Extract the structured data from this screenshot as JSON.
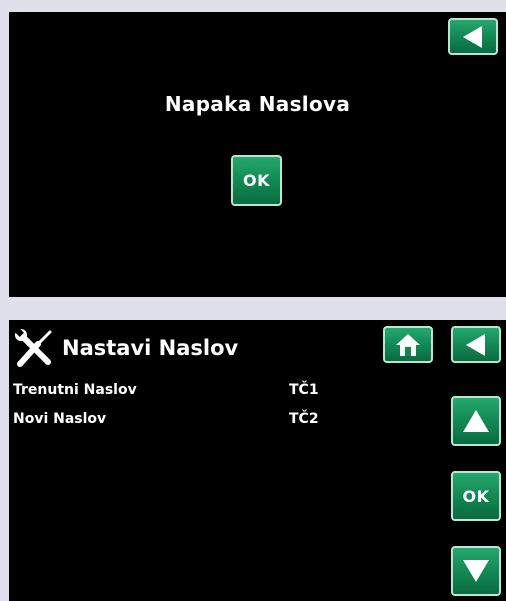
{
  "dialog": {
    "title": "Napaka Naslova",
    "ok_label": "OK"
  },
  "address_screen": {
    "title": "Nastavi Naslov",
    "rows": [
      {
        "label": "Trenutni Naslov",
        "value": "TČ1"
      },
      {
        "label": "Novi Naslov",
        "value": "TČ2"
      }
    ],
    "ok_label": "OK"
  },
  "icons": {
    "back": "back-arrow-icon",
    "home": "home-icon",
    "up": "up-arrow-icon",
    "down": "down-arrow-icon",
    "tools": "tools-icon"
  },
  "colors": {
    "background": "#000000",
    "button_green": "#118653",
    "button_border": "#b9e6cf",
    "text": "#ffffff",
    "page_bg": "#dfe0ec"
  }
}
